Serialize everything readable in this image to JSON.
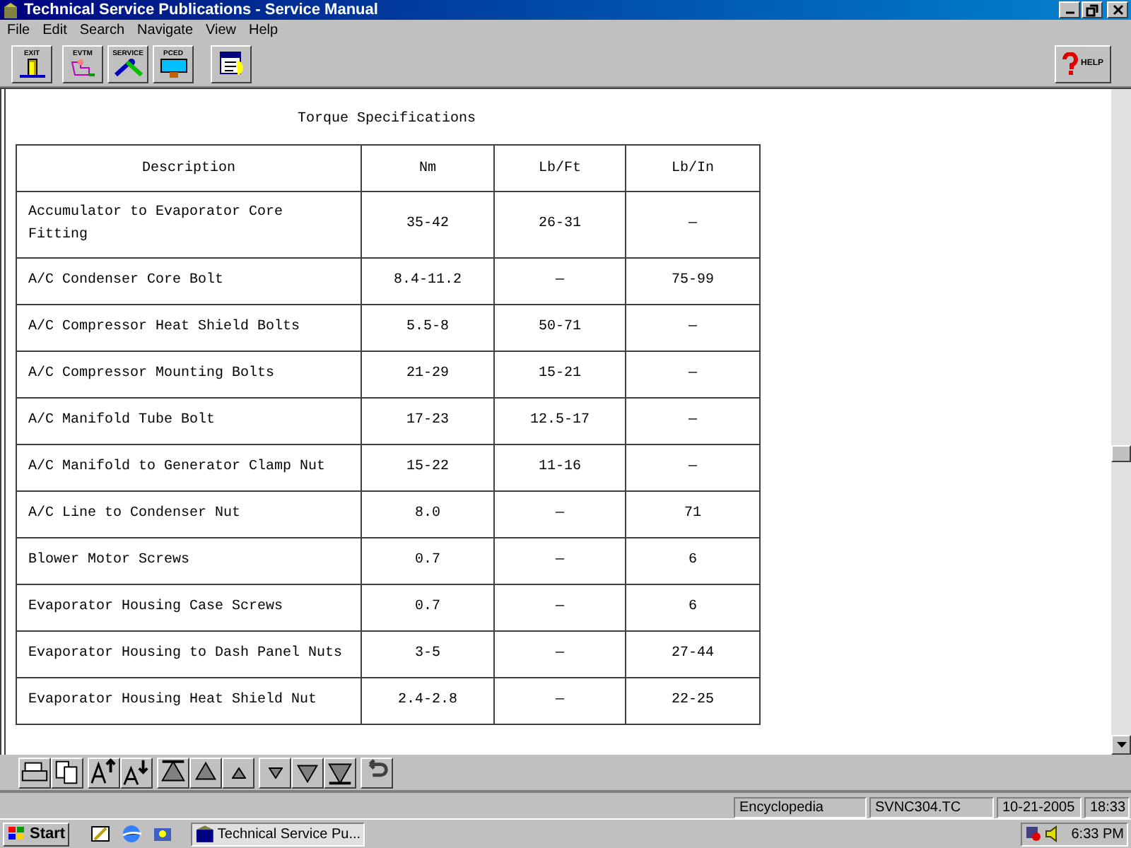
{
  "window": {
    "title": "Technical Service Publications - Service Manual"
  },
  "menu": [
    "File",
    "Edit",
    "Search",
    "Navigate",
    "View",
    "Help"
  ],
  "toolbar": [
    {
      "kind": "exit",
      "label": "EXIT"
    },
    {
      "kind": "evtm",
      "label": "EVTM"
    },
    {
      "kind": "service",
      "label": "SERVICE"
    },
    {
      "kind": "pced",
      "label": "PCED"
    },
    {
      "kind": "calendar"
    }
  ],
  "help_button": {
    "label": "HELP"
  },
  "document": {
    "title": "Torque Specifications",
    "columns": [
      "Description",
      "Nm",
      "Lb/Ft",
      "Lb/In"
    ],
    "rows": [
      [
        "Accumulator to Evaporator Core Fitting",
        "35-42",
        "26-31",
        "—"
      ],
      [
        "A/C Condenser Core Bolt",
        "8.4-11.2",
        "—",
        "75-99"
      ],
      [
        "A/C Compressor Heat Shield Bolts",
        "5.5-8",
        "50-71",
        "—"
      ],
      [
        "A/C Compressor Mounting Bolts",
        "21-29",
        "15-21",
        "—"
      ],
      [
        "A/C Manifold Tube Bolt",
        "17-23",
        "12.5-17",
        "—"
      ],
      [
        "A/C Manifold to Generator Clamp Nut",
        "15-22",
        "11-16",
        "—"
      ],
      [
        "A/C Line to Condenser Nut",
        "8.0",
        "—",
        "71"
      ],
      [
        "Blower Motor Screws",
        "0.7",
        "—",
        "6"
      ],
      [
        "Evaporator Housing Case Screws",
        "0.7",
        "—",
        "6"
      ],
      [
        "Evaporator Housing to Dash Panel Nuts",
        "3-5",
        "—",
        "27-44"
      ],
      [
        "Evaporator Housing Heat Shield Nut",
        "2.4-2.8",
        "—",
        "22-25"
      ]
    ]
  },
  "nav_toolbar": [
    {
      "kind": "print"
    },
    {
      "kind": "copy"
    },
    {
      "kind": "font-up"
    },
    {
      "kind": "font-down"
    },
    {
      "kind": "first"
    },
    {
      "kind": "prev-big"
    },
    {
      "kind": "prev"
    },
    {
      "kind": "next"
    },
    {
      "kind": "next-big"
    },
    {
      "kind": "last"
    },
    {
      "kind": "back"
    }
  ],
  "status_bar": [
    "Encyclopedia",
    "SVNC304.TC",
    "10-21-2005",
    "18:33"
  ],
  "taskbar": {
    "start": "Start",
    "quick_launch": [
      {
        "kind": "desktop"
      },
      {
        "kind": "browser"
      },
      {
        "kind": "channels"
      }
    ],
    "tasks": [
      {
        "label": "Technical Service Pu...",
        "selected": true
      }
    ],
    "clock": "6:33 PM"
  }
}
